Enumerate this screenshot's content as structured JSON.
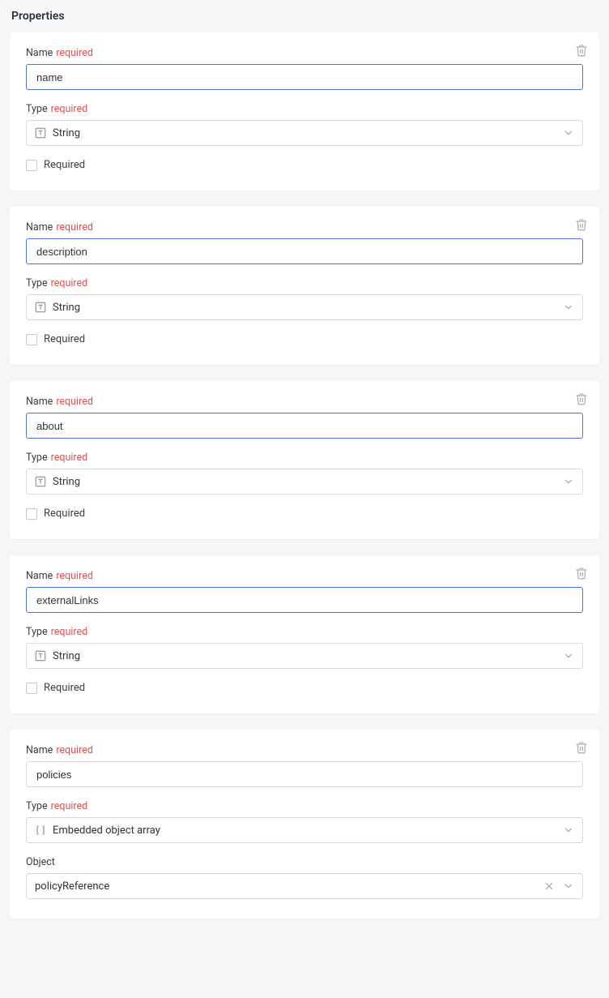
{
  "section_title": "Properties",
  "labels": {
    "name": "Name",
    "type": "Type",
    "object": "Object",
    "required_tag": "required",
    "required_checkbox": "Required"
  },
  "properties": [
    {
      "name_value": "name",
      "type_value": "String",
      "type_icon": "text",
      "required_checked": false,
      "name_highlighted": true,
      "show_required_checkbox": true,
      "object_value": null
    },
    {
      "name_value": "description",
      "type_value": "String",
      "type_icon": "text",
      "required_checked": false,
      "name_highlighted": true,
      "show_required_checkbox": true,
      "object_value": null
    },
    {
      "name_value": "about",
      "type_value": "String",
      "type_icon": "text",
      "required_checked": false,
      "name_highlighted": true,
      "show_required_checkbox": true,
      "object_value": null
    },
    {
      "name_value": "externalLinks",
      "type_value": "String",
      "type_icon": "text",
      "required_checked": false,
      "name_highlighted": true,
      "show_required_checkbox": true,
      "object_value": null
    },
    {
      "name_value": "policies",
      "type_value": "Embedded object array",
      "type_icon": "array",
      "required_checked": false,
      "name_highlighted": false,
      "show_required_checkbox": false,
      "object_value": "policyReference"
    }
  ]
}
